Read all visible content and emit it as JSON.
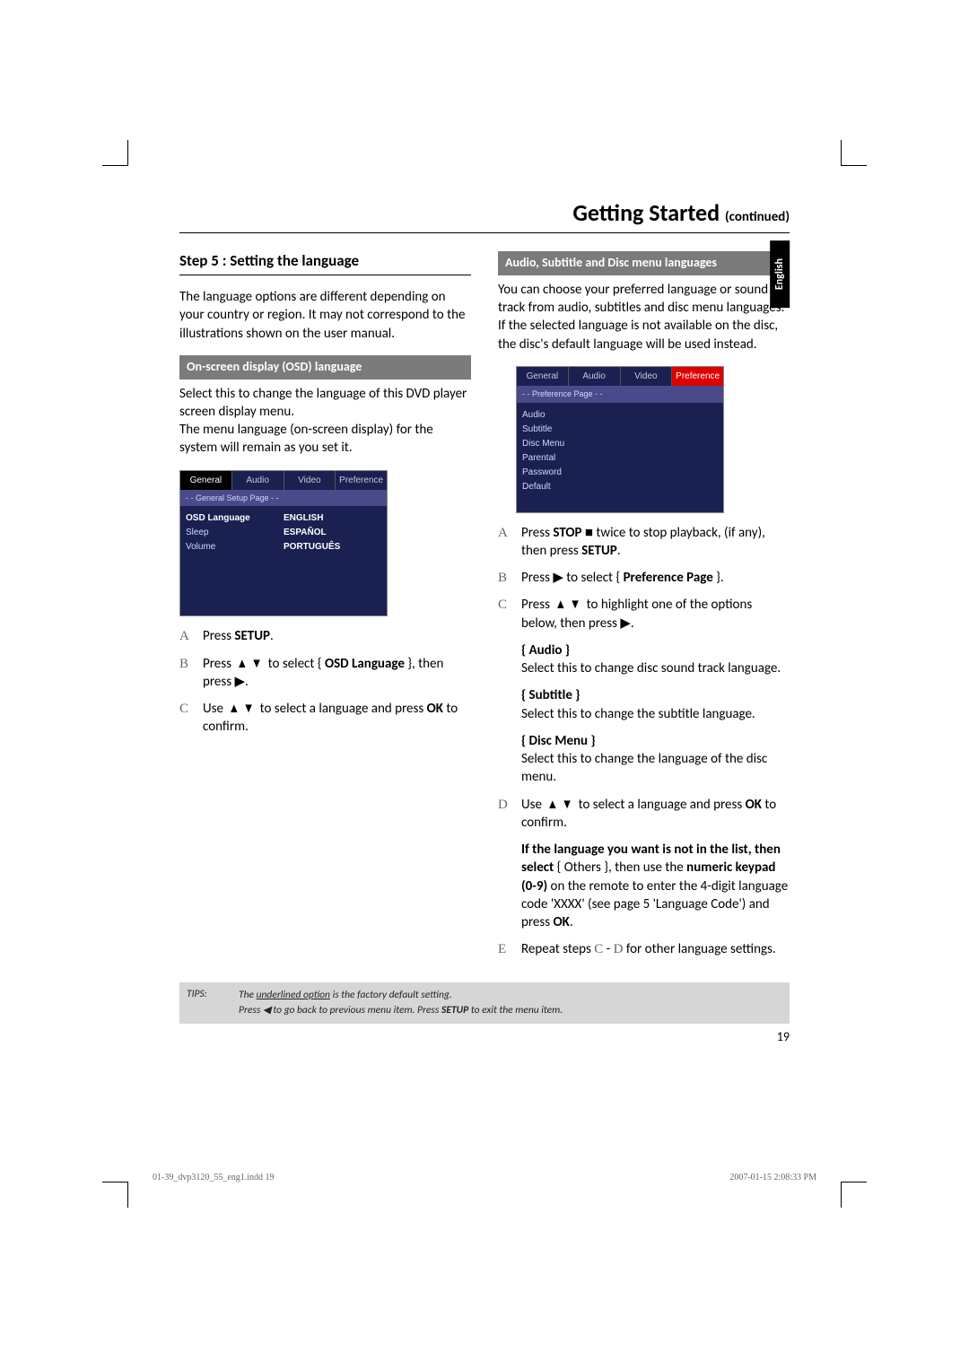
{
  "header": {
    "title": "Getting Started",
    "continued": "(continued)"
  },
  "languageTab": "English",
  "left": {
    "stepHeading": "Step 5 : Setting the language",
    "intro": "The language options are different depending on your country or region. It may not correspond to the illustrations shown on the user manual.",
    "subHeading": "On-screen display (OSD) language",
    "desc": "Select this to change the language of this DVD player screen display menu.\nThe menu language (on-screen display) for the system will remain as you set it.",
    "osd": {
      "tabs": [
        "General",
        "Audio",
        "Video",
        "Preference"
      ],
      "activeTab": 0,
      "bar": "- -   General Setup Page   - -",
      "leftItems": [
        "OSD Language",
        "Sleep",
        "Volume"
      ],
      "leftHighlight": 0,
      "rightItems": [
        "ENGLISH",
        "ESPAÑOL",
        "PORTUGUÊS"
      ],
      "rightBold": [
        1,
        2
      ]
    },
    "stepsLetters": [
      "A",
      "B",
      "C"
    ],
    "stepA": {
      "label": "A",
      "prefix": "Press ",
      "bold": "SETUP",
      "suffix": "."
    },
    "stepB": {
      "label": "B",
      "prefix": "Press  ",
      "arrows": "▲  ▼",
      "mid": "  to select { ",
      "bold": "OSD Language",
      "suffix": " }, then press  ▶."
    },
    "stepC": {
      "label": "C",
      "prefix": "Use  ",
      "arrows": "▲  ▼",
      "mid": "  to select a language and press ",
      "bold": "OK",
      "suffix": " to confirm."
    }
  },
  "right": {
    "subHeading": "Audio, Subtitle and Disc menu languages",
    "intro": "You can choose your preferred language or sound track from audio, subtitles and disc menu languages. If the selected language is not available on the disc, the disc's default language will be used instead.",
    "osd": {
      "tabs": [
        "General",
        "Audio",
        "Video",
        "Preference"
      ],
      "prefTabIndex": 3,
      "bar": "- -   Preference Page   - -",
      "leftItems": [
        "Audio",
        "Subtitle",
        "Disc Menu",
        "Parental",
        "Password",
        "Default"
      ]
    },
    "stepA": {
      "label": "A",
      "t1": "Press ",
      "b1": "STOP",
      "t2": " ■    twice to stop playback, (if any), then press ",
      "b2": "SETUP",
      "t3": "."
    },
    "stepB": {
      "label": "B",
      "t1": "Press  ▶ to select { ",
      "b1": "Preference Page",
      "t2": " }."
    },
    "stepC": {
      "label": "C",
      "t1": "Press  ",
      "arrows": "▲  ▼",
      "t2": "  to highlight one of the options below, then press  ▶."
    },
    "optAudio": {
      "label": "{ Audio }",
      "desc": "Select this to change disc sound track language."
    },
    "optSubtitle": {
      "label": "{ Subtitle }",
      "desc": "Select this to change the subtitle language."
    },
    "optDisc": {
      "label": "{ Disc Menu }",
      "desc": "Select this to change the language of the disc menu."
    },
    "stepD": {
      "label": "D",
      "t1": "Use  ",
      "arrows": "▲  ▼",
      "t2": "  to select a language and press ",
      "b1": "OK",
      "t3": " to confirm."
    },
    "note": {
      "b1": "If the language you want is not in the list, then select",
      "t1": " { Others }, then use the ",
      "b2": "numeric keypad (0-9)",
      "t2": " on the remote to enter the 4-digit language code 'XXXX' (see page 5 'Language Code') and press ",
      "b3": "OK",
      "t3": "."
    },
    "stepE": {
      "label": "E",
      "t1": "Repeat steps ",
      "c": "C",
      "t2": " - ",
      "d": "D",
      "t3": "  for other language settings."
    }
  },
  "tips": {
    "label": "TIPS:",
    "line1a": "The ",
    "line1u": "underlined option",
    "line1b": " is the factory default setting.",
    "line2a": "Press  ◀ to go back to previous menu item. Press ",
    "line2b": "SETUP",
    "line2c": " to exit the menu item."
  },
  "pageNumber": "19",
  "footer": {
    "left": "01-39_dvp3120_55_eng1.indd   19",
    "right": "2007-01-15   2:08:33 PM"
  }
}
